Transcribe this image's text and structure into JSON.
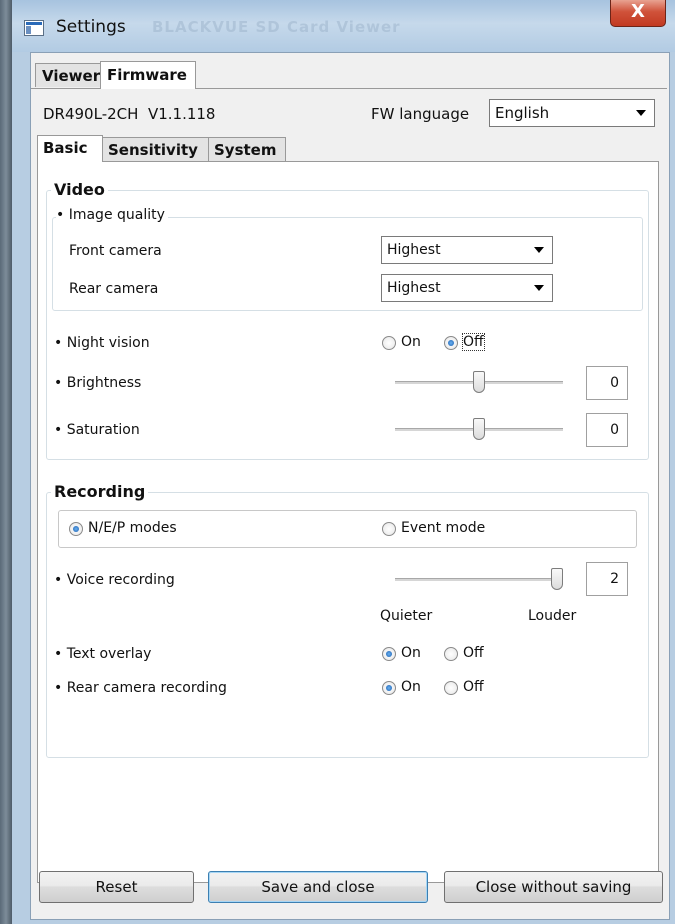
{
  "window": {
    "title": "Settings",
    "background_title": "BLACKVUE SD Card Viewer",
    "close_glyph": "X"
  },
  "outer_tabs": [
    "Viewer",
    "Firmware"
  ],
  "header": {
    "model": "DR490L-2CH",
    "version": "V1.1.118",
    "fw_language_label": "FW language",
    "fw_language_value": "English"
  },
  "inner_tabs": [
    "Basic",
    "Sensitivity",
    "System"
  ],
  "video": {
    "title": "Video",
    "image_quality_label": "• Image quality",
    "front_camera_label": "Front camera",
    "front_camera_value": "Highest",
    "rear_camera_label": "Rear camera",
    "rear_camera_value": "Highest",
    "night_vision_label": "• Night vision",
    "night_vision_on": "On",
    "night_vision_off": "Off",
    "night_vision_selected": "Off",
    "brightness_label": "• Brightness",
    "brightness_value": "0",
    "brightness_fraction": 0.5,
    "saturation_label": "• Saturation",
    "saturation_value": "0",
    "saturation_fraction": 0.5
  },
  "recording": {
    "title": "Recording",
    "mode_nep": "N/E/P modes",
    "mode_event": "Event mode",
    "mode_selected": "N/E/P modes",
    "voice_label": "• Voice recording",
    "voice_value": "2",
    "voice_fraction": 1.0,
    "quieter": "Quieter",
    "louder": "Louder",
    "text_overlay_label": "• Text overlay",
    "text_overlay_on": "On",
    "text_overlay_off": "Off",
    "text_overlay_selected": "On",
    "rear_rec_label": "• Rear camera recording",
    "rear_rec_on": "On",
    "rear_rec_off": "Off",
    "rear_rec_selected": "On"
  },
  "buttons": {
    "reset": "Reset",
    "save_close": "Save and close",
    "close_no_save": "Close without saving"
  },
  "colors": {
    "accent": "#1a5fb0",
    "close_button": "#c23a22",
    "window_frame": "#b7cde2"
  }
}
